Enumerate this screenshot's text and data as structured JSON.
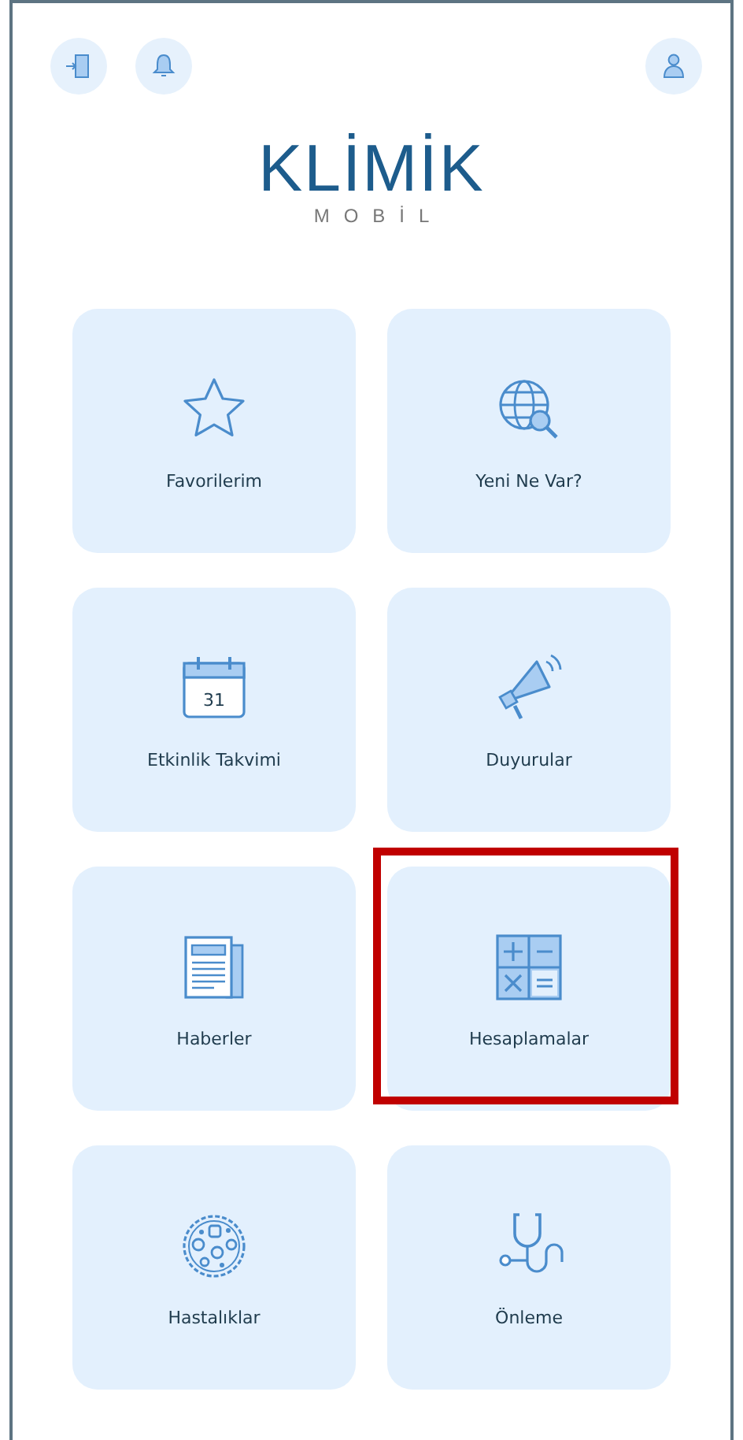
{
  "top_bar": {
    "left_buttons": [
      {
        "kind": "exit"
      },
      {
        "kind": "bell"
      }
    ],
    "right_buttons": [
      {
        "kind": "user"
      }
    ]
  },
  "logo": {
    "title": "KLİMİK",
    "subtitle": "MOBİL"
  },
  "tiles": [
    {
      "label": "Favorilerim",
      "kind": "star",
      "highlighted": false
    },
    {
      "label": "Yeni Ne Var?",
      "kind": "globe",
      "highlighted": false
    },
    {
      "label": "Etkinlik Takvimi",
      "kind": "calendar",
      "icon_text": "31",
      "highlighted": false
    },
    {
      "label": "Duyurular",
      "kind": "megaphone",
      "highlighted": false
    },
    {
      "label": "Haberler",
      "kind": "newspaper",
      "highlighted": false
    },
    {
      "label": "Hesaplamalar",
      "kind": "calculator",
      "highlighted": true
    },
    {
      "label": "Hastalıklar",
      "kind": "germ",
      "highlighted": false
    },
    {
      "label": "Önleme",
      "kind": "stethoscope",
      "highlighted": false
    }
  ]
}
